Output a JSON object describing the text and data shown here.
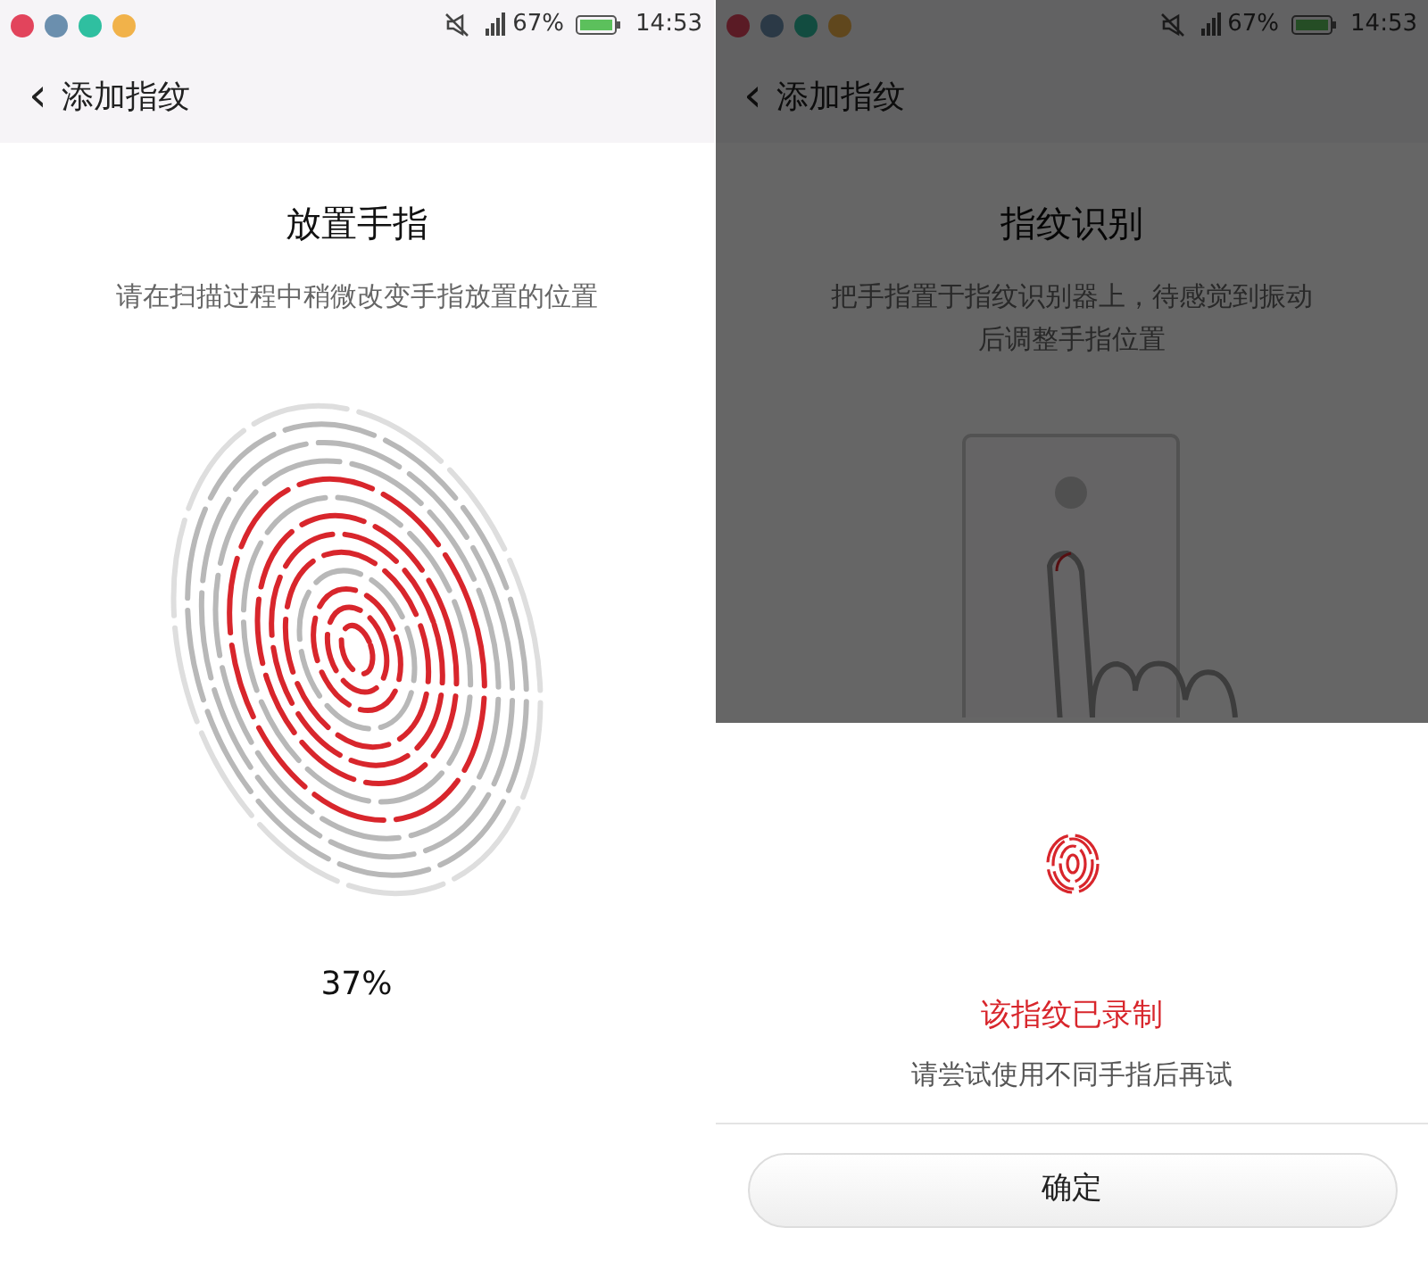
{
  "screens": [
    {
      "status_bar": {
        "battery": "67%",
        "time": "14:53"
      },
      "header": {
        "back": "‹",
        "title": "添加指纹"
      },
      "title": "放置手指",
      "subtitle": "请在扫描过程中稍微改变手指放置的位置",
      "scan": {
        "reading": "37%"
      }
    },
    {
      "status_bar": {
        "battery": "67%",
        "time": "14:53"
      },
      "header": {
        "back": "‹",
        "title": "添加指纹"
      },
      "title": "指纹识别",
      "subtitle": "把手指置于指纹识别器上，待感觉到振动后调整手指位置",
      "dimmed": true,
      "sheet": {
        "title": "该指纹已录制",
        "message": "请尝试使用不同手指后再试",
        "button": "确定"
      }
    }
  ]
}
